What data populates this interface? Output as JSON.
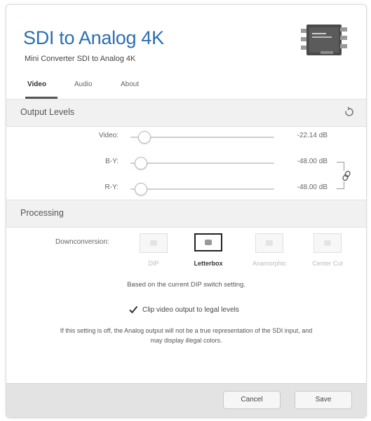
{
  "header": {
    "title": "SDI to Analog 4K",
    "subtitle": "Mini Converter SDI to Analog 4K",
    "device_icon": "mini-converter-device-image"
  },
  "tabs": [
    {
      "label": "Video",
      "active": true
    },
    {
      "label": "Audio",
      "active": false
    },
    {
      "label": "About",
      "active": false
    }
  ],
  "output_levels": {
    "section_title": "Output Levels",
    "reset_icon": "reset-icon",
    "rows": [
      {
        "label": "Video:",
        "value": "-22.14 dB"
      },
      {
        "label": "B-Y:",
        "value": "-48.00 dB"
      },
      {
        "label": "R-Y:",
        "value": "-48.00 dB"
      }
    ],
    "link_icon": "link-icon"
  },
  "processing": {
    "section_title": "Processing",
    "downconversion_label": "Downconversion:",
    "options": [
      {
        "label": "DIP",
        "selected": false
      },
      {
        "label": "Letterbox",
        "selected": true
      },
      {
        "label": "Anamorphic",
        "selected": false
      },
      {
        "label": "Center Cut",
        "selected": false
      }
    ],
    "dip_note": "Based on the current DIP switch setting.",
    "clip_checkbox": {
      "label": "Clip video output to legal levels",
      "checked": true
    },
    "clip_note_line1": "If this setting is off, the Analog output will not be a true representation of the SDI input, and",
    "clip_note_line2": "may display illegal colors."
  },
  "footer": {
    "cancel_label": "Cancel",
    "save_label": "Save"
  },
  "colors": {
    "title": "#2b6fb3",
    "section_bg": "#f1f1f1",
    "footer_bg": "#e3e3e3"
  }
}
